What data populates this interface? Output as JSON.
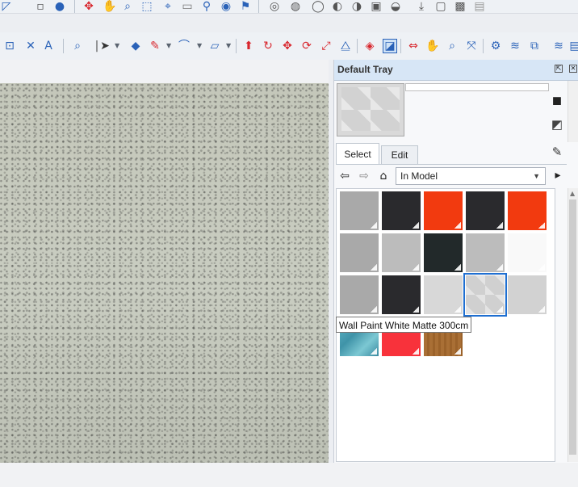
{
  "tray": {
    "title": "Default Tray",
    "pin_glyph": "⇱",
    "close_glyph": "✕",
    "tabs": [
      {
        "label": "Select",
        "active": true
      },
      {
        "label": "Edit",
        "active": false
      }
    ],
    "collection_select": "In Model",
    "tooltip": "Wall Paint White Matte 300cm"
  },
  "icons": {
    "back": "⇦",
    "forward": "⇨",
    "home": "⌂",
    "details": "▸",
    "sample": "✎",
    "create": "◼",
    "toggle": "◩"
  },
  "swatches": [
    {
      "color": "#a9a9a9"
    },
    {
      "color": "#2a2a2d"
    },
    {
      "color": "#f23a0f"
    },
    {
      "color": "#2a2a2d"
    },
    {
      "color": "#f23a0f"
    },
    {
      "color": "#a9a9a9"
    },
    {
      "color": "#bcbcbc"
    },
    {
      "color": "#22292a"
    },
    {
      "color": "#bcbcbc"
    },
    {
      "color": "#f9f9f9"
    },
    {
      "color": "#a9a9a9"
    },
    {
      "color": "#2a2a2d"
    },
    {
      "color": "#d8d8d8"
    },
    {
      "color": "#e3e3e3",
      "selected": true
    },
    {
      "color": "#d2d2d2"
    },
    {
      "color": "#4ea9bb"
    },
    {
      "color": "#f8323b"
    },
    {
      "color": "#a06a34"
    }
  ],
  "colors": {
    "accent": "#1f6fd1",
    "tray_header": "#d7e6f6",
    "toolbar_red": "#d8262d",
    "toolbar_blue": "#2a62b8"
  }
}
